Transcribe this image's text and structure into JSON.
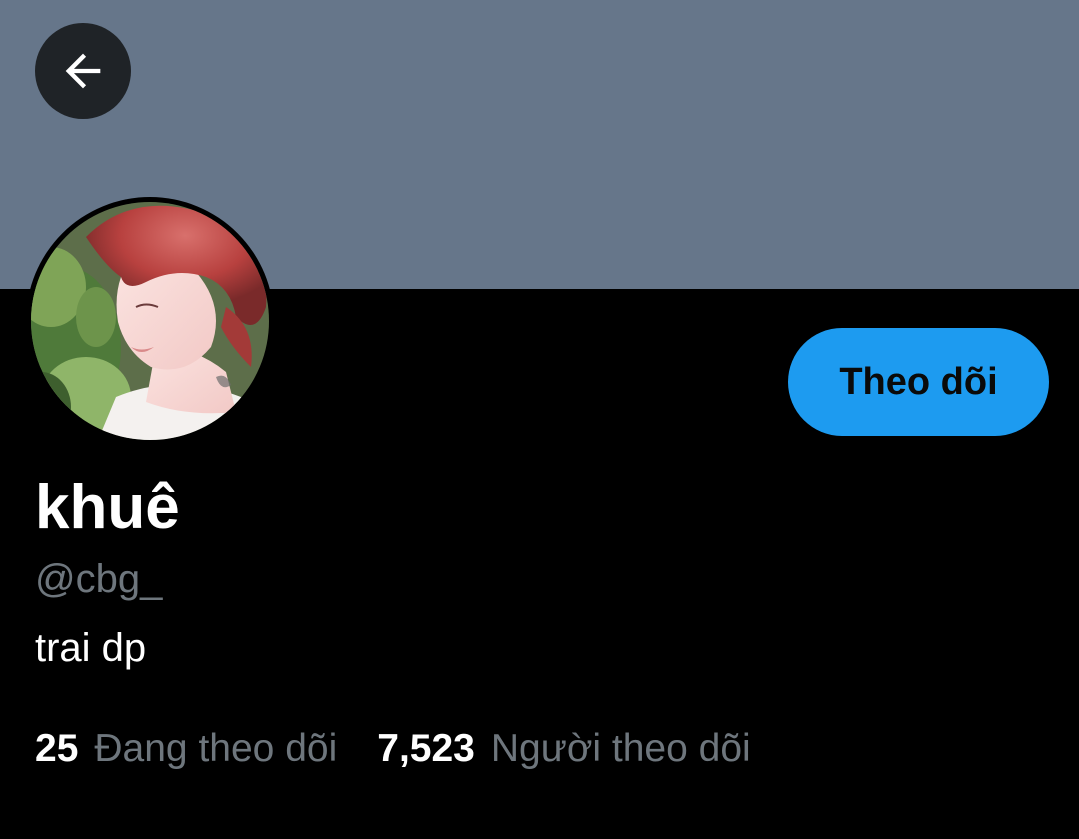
{
  "header": {
    "back_icon": "arrow-left-icon",
    "banner_color": "#66768a"
  },
  "profile": {
    "display_name": "khuê",
    "handle": "@cbg_",
    "bio": "trai dp",
    "follow_button_label": "Theo dõi",
    "accent_color": "#1d9bf0"
  },
  "stats": {
    "following": {
      "count": "25",
      "label": "Đang theo dõi"
    },
    "followers": {
      "count": "7,523",
      "label": "Người theo dõi"
    }
  }
}
